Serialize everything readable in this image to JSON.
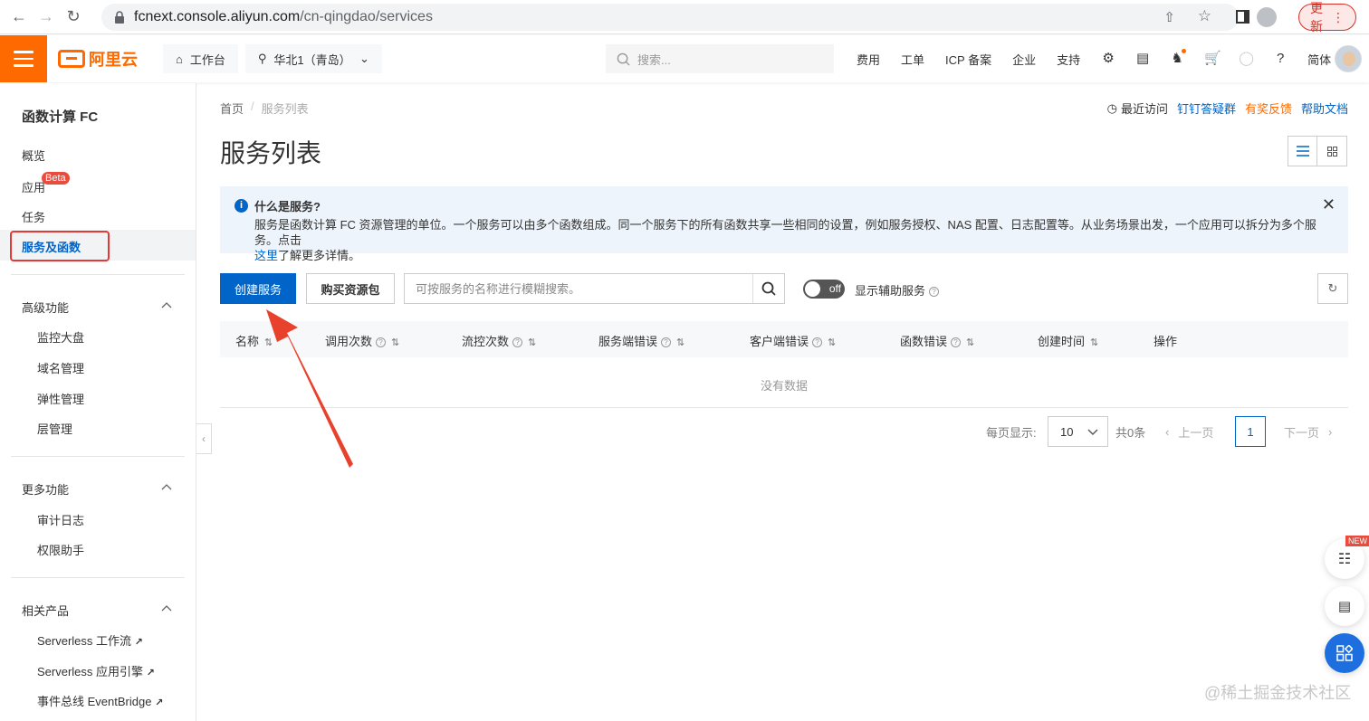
{
  "browser": {
    "url_host": "fcnext.console.aliyun.com",
    "url_path": "/cn-qingdao/services",
    "update_label": "更新"
  },
  "topnav": {
    "logo_text": "阿里云",
    "workbench": "工作台",
    "region": "华北1（青岛）",
    "search_placeholder": "搜索...",
    "links": [
      "费用",
      "工单",
      "ICP 备案",
      "企业",
      "支持"
    ],
    "lang": "简体"
  },
  "sidebar": {
    "title": "函数计算 FC",
    "items": [
      "概览",
      "应用",
      "任务",
      "服务及函数"
    ],
    "beta_badge": "Beta",
    "groups": [
      {
        "title": "高级功能",
        "items": [
          "监控大盘",
          "域名管理",
          "弹性管理",
          "层管理"
        ]
      },
      {
        "title": "更多功能",
        "items": [
          "审计日志",
          "权限助手"
        ]
      },
      {
        "title": "相关产品",
        "items": [
          "Serverless 工作流",
          "Serverless 应用引擎",
          "事件总线 EventBridge"
        ]
      }
    ]
  },
  "breadcrumb": {
    "home": "首页",
    "current": "服务列表"
  },
  "top_links": {
    "recent": "最近访问",
    "dingtalk": "钉钉答疑群",
    "feedback": "有奖反馈",
    "help": "帮助文档",
    "colors": {
      "blue": "#0064c8",
      "orange": "#ff6a00"
    }
  },
  "page": {
    "title": "服务列表"
  },
  "info": {
    "title": "什么是服务?",
    "text": "服务是函数计算 FC 资源管理的单位。一个服务可以由多个函数组成。同一个服务下的所有函数共享一些相同的设置，例如服务授权、NAS 配置、日志配置等。从业务场景出发，一个应用可以拆分为多个服务。点击",
    "link": "这里",
    "text_after": "了解更多详情。"
  },
  "toolbar": {
    "create": "创建服务",
    "buy": "购买资源包",
    "filter_placeholder": "可按服务的名称进行模糊搜索。",
    "switch_state": "off",
    "switch_label": "显示辅助服务"
  },
  "table": {
    "columns": [
      "名称",
      "调用次数",
      "流控次数",
      "服务端错误",
      "客户端错误",
      "函数错误",
      "创建时间",
      "操作"
    ],
    "empty_text": "没有数据"
  },
  "pagination": {
    "page_size_label": "每页显示:",
    "page_size": "10",
    "total": "共0条",
    "prev": "上一页",
    "next": "下一页",
    "current": "1"
  },
  "floating": {
    "new_badge": "NEW"
  },
  "watermark": "@稀土掘金技术社区"
}
